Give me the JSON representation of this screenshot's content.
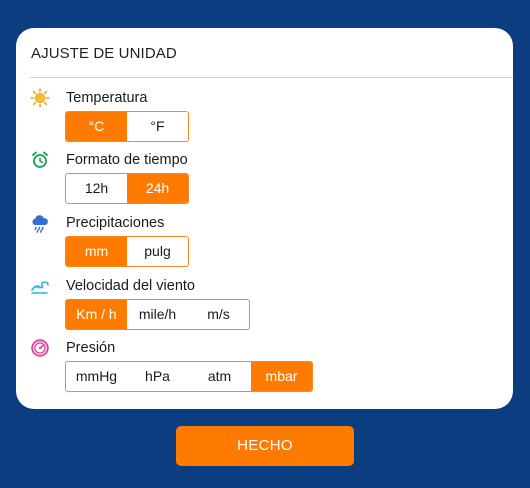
{
  "title": "AJUSTE DE UNIDAD",
  "sections": {
    "temperature": {
      "label": "Temperatura",
      "icon": "sun-icon",
      "options": [
        "°C",
        "°F"
      ],
      "selected": "°C"
    },
    "time_format": {
      "label": "Formato de tiempo",
      "icon": "alarm-clock-icon",
      "options": [
        "12h",
        "24h"
      ],
      "selected": "24h"
    },
    "precipitation": {
      "label": "Precipitaciones",
      "icon": "rain-cloud-icon",
      "options": [
        "mm",
        "pulg"
      ],
      "selected": "mm"
    },
    "wind_speed": {
      "label": "Velocidad del viento",
      "icon": "wind-icon",
      "options": [
        "Km / h",
        "mile/h",
        "m/s"
      ],
      "selected": "Km / h"
    },
    "pressure": {
      "label": "Presión",
      "icon": "pressure-gauge-icon",
      "options": [
        "mmHg",
        "hPa",
        "atm",
        "mbar"
      ],
      "selected": "mbar"
    }
  },
  "done_button": "HECHO",
  "colors": {
    "background": "#0b3d80",
    "accent": "#ff7b00",
    "card": "#ffffff"
  }
}
